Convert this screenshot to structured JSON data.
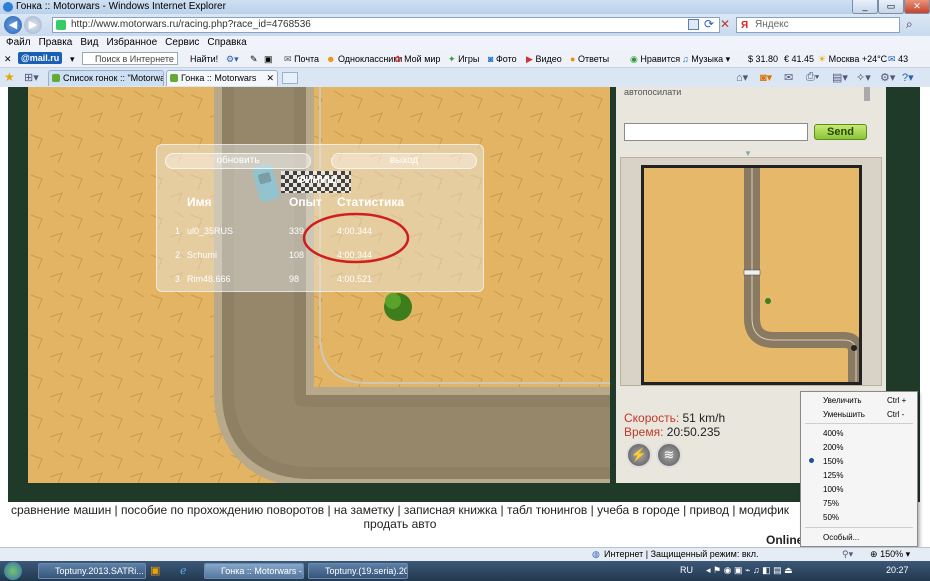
{
  "window": {
    "title": "Гонка :: Motorwars - Windows Internet Explorer",
    "url": "http://www.motorwars.ru/racing.php?race_id=4768536",
    "search_placeholder": "Яндекс"
  },
  "menu": [
    "Файл",
    "Правка",
    "Вид",
    "Избранное",
    "Сервис",
    "Справка"
  ],
  "toolbar": {
    "mail_logo": "@mail.ru",
    "search_placeholder": "Поиск в Интернете",
    "find_button": "Найти!",
    "links": [
      "Почта",
      "Одноклассники",
      "Мой мир",
      "Игры",
      "Фото",
      "Видео",
      "Ответы"
    ],
    "like": "Нравится",
    "music": "Музыка",
    "usd": "$ 31.80",
    "eur": "€ 41.45",
    "weather": "Москва +24°C",
    "mail_count": "43"
  },
  "tabs": [
    {
      "label": "Список гонок :: \"Motorwa...",
      "active": false
    },
    {
      "label": "Гонка :: Motorwars",
      "active": true
    }
  ],
  "game": {
    "refresh_button": "обновить",
    "exit_button": "выход",
    "finish_sign": "ФИНИШ",
    "headers": {
      "name": "Имя",
      "exp": "Опыт",
      "stats": "Статистика"
    },
    "results": [
      {
        "pos": "1",
        "name": "ul0_35RUS",
        "exp": "339",
        "time": "4:00.344"
      },
      {
        "pos": "2",
        "name": "Schumi",
        "exp": "108",
        "time": "4:00.344"
      },
      {
        "pos": "3",
        "name": "Rim48.666",
        "exp": "98",
        "time": "4:00.521"
      }
    ]
  },
  "side": {
    "chat_partial": "автопосилати",
    "send_button": "Send",
    "speed_label": "Скорость:",
    "speed_value": "51 km/h",
    "time_label": "Время:",
    "time_value": "20:50.235"
  },
  "footer": {
    "links_line1": "сравнение машин | пособие по прохождению поворотов | на заметку | записная книжка | табл тюнингов | учеба в городе | привод | модифик",
    "links_line2": "продать авто",
    "online": "Online"
  },
  "zoom_menu": {
    "zoom_in": "Увеличить",
    "zoom_in_shortcut": "Ctrl +",
    "zoom_out": "Уменьшить",
    "zoom_out_shortcut": "Ctrl -",
    "levels": [
      "400%",
      "200%",
      "150%",
      "125%",
      "100%",
      "75%",
      "50%"
    ],
    "selected": "150%",
    "custom": "Особый..."
  },
  "statusbar": {
    "zone": "Интернет | Защищенный режим: вкл.",
    "zoom": "150%"
  },
  "taskbar": {
    "items": [
      "Toptuny.2013.SATRi...",
      "Гонка :: Motorwars -...",
      "Toptuny.(19.seria).20..."
    ],
    "lang": "RU",
    "clock": "20:27"
  }
}
